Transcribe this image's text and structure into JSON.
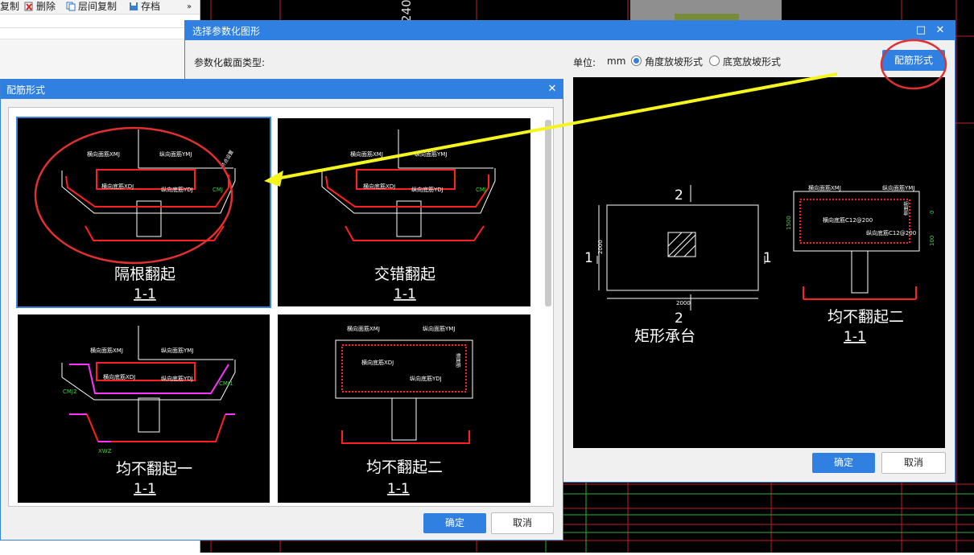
{
  "toolbar": {
    "copy": "复制",
    "delete": "删除",
    "floor_copy": "层间复制",
    "save": "存档",
    "more": "»"
  },
  "cad_bg": {
    "dim_label": "240"
  },
  "param_dialog": {
    "title": "选择参数化图形",
    "section_type_label": "参数化截面类型:",
    "unit_label": "单位:",
    "unit_value": "mm",
    "option_angle": "角度放坡形式",
    "option_bottom": "底宽放坡形式",
    "rebar_button": "配筋形式",
    "ok": "确定",
    "cancel": "取消",
    "preview": {
      "plan_name": "矩形承台",
      "section_mark": "2",
      "side_mark": "1",
      "dim_width": "2000",
      "dim_height": "2000",
      "section_name": "均不翻起二",
      "section_label": "1-1",
      "lbl_hxmj": "横向面筋XMJ",
      "lbl_zxmj": "纵向面筋YMJ",
      "lbl_hxdj": "横向底筋C12@200",
      "lbl_zxdj": "纵向底筋C12@200",
      "lbl_side": "侧面筋",
      "dim_1500": "1500",
      "dim_100": "100",
      "dim_0": "0"
    }
  },
  "rebar_dialog": {
    "title": "配筋形式",
    "ok": "确定",
    "cancel": "取消",
    "options": [
      {
        "name": "隔根翻起",
        "label": "1-1"
      },
      {
        "name": "交错翻起",
        "label": "1-1"
      },
      {
        "name": "均不翻起一",
        "label": "1-1"
      },
      {
        "name": "均不翻起二",
        "label": "1-1"
      }
    ],
    "lbl_hxmj": "横向面筋XMJ",
    "lbl_zxmj": "纵向面筋YMJ",
    "lbl_hxdj": "横向底筋XDJ",
    "lbl_zxdj": "纵向底筋YDJ",
    "lbl_cmj": "CMJ",
    "lbl_cmj1": "CMJ1",
    "lbl_cmj2": "CMJ2",
    "lbl_xwz": "XWZ",
    "lbl_side": "侧面筋",
    "lbl_side_note": "节点设置"
  },
  "colors": {
    "accent": "#2f80e0",
    "rebar_red": "#ff2020",
    "label_green": "#33dd33",
    "magenta": "#ff33ff",
    "annotation_yellow": "#f5f51e",
    "highlight_circle": "#e23030"
  }
}
